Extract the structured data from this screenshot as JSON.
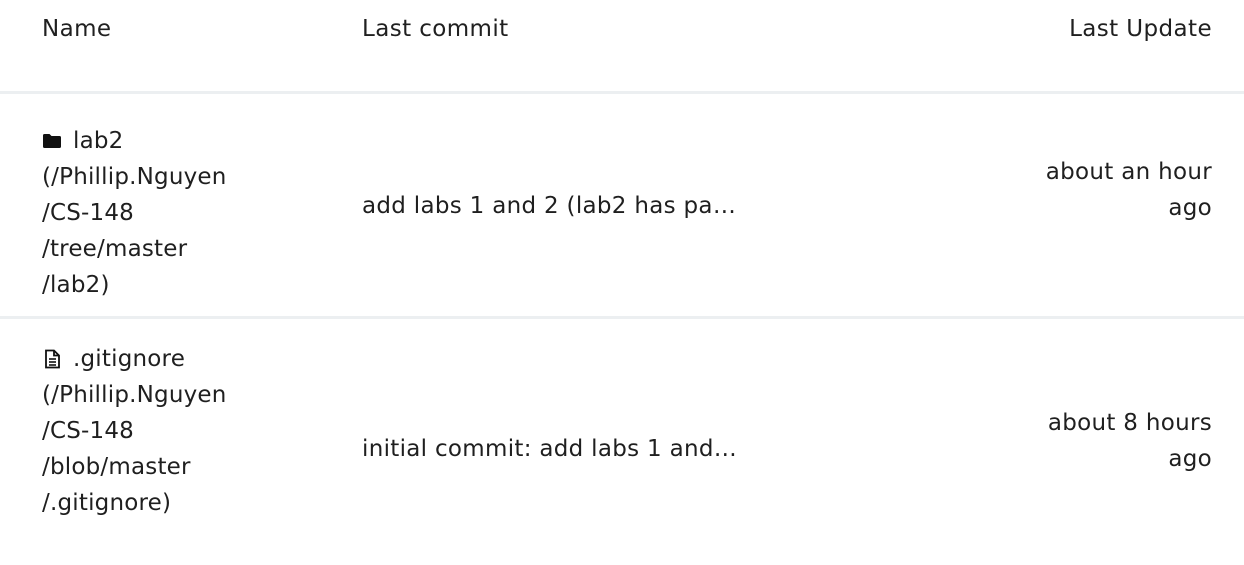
{
  "table": {
    "headers": {
      "name": "Name",
      "last_commit": "Last commit",
      "last_update": "Last Update"
    },
    "rows": [
      {
        "icon": "folder-icon",
        "name": "lab2",
        "link_lines": [
          "(/Phillip.Nguyen",
          "/CS-148",
          "/tree/master",
          "/lab2)"
        ],
        "last_commit": "add labs 1 and 2 (lab2 has pa…",
        "last_update_lines": [
          "about an hour",
          "ago"
        ]
      },
      {
        "icon": "file-text-icon",
        "name": ".gitignore",
        "link_lines": [
          "(/Phillip.Nguyen",
          "/CS-148",
          "/blob/master",
          "/.gitignore)"
        ],
        "last_commit": "initial commit: add labs 1 and…",
        "last_update_lines": [
          "about 8 hours",
          "ago"
        ]
      }
    ]
  }
}
